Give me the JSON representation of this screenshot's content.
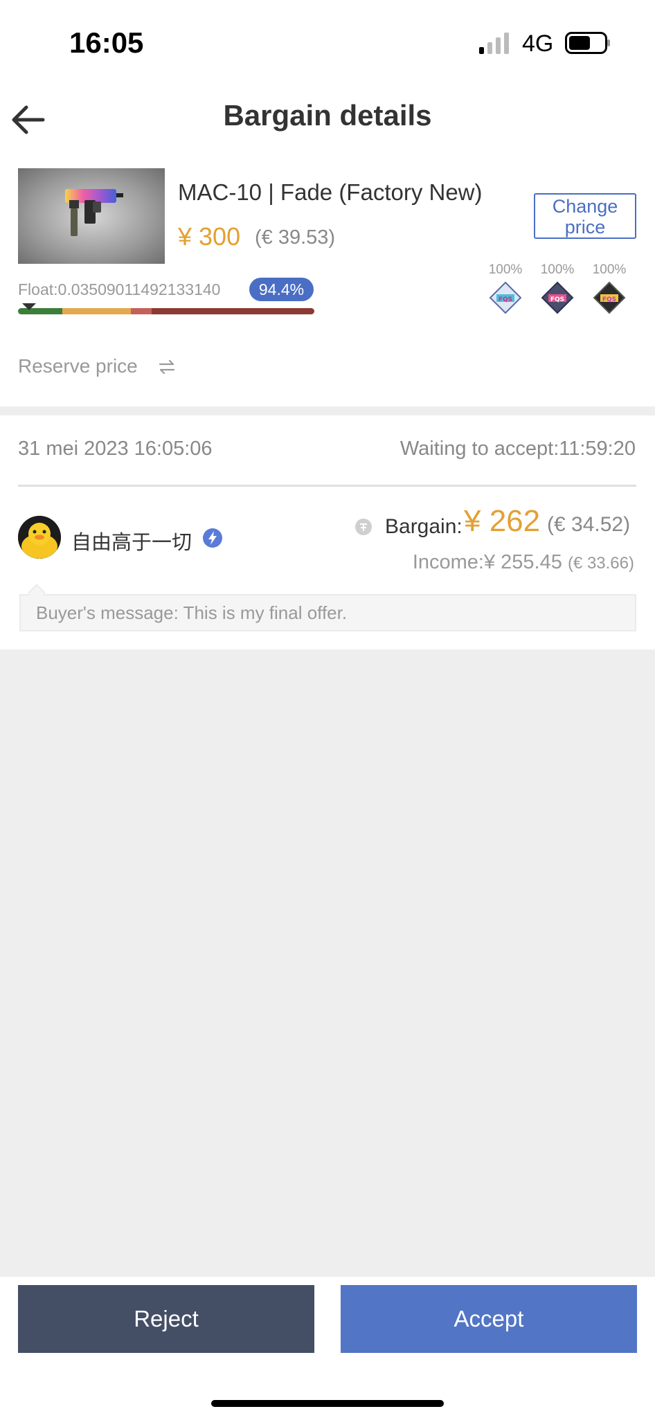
{
  "status_bar": {
    "time": "16:05",
    "network": "4G",
    "icons": [
      "signal-icon",
      "battery-icon"
    ]
  },
  "nav": {
    "title": "Bargain details",
    "back_icon": "arrow-left-icon"
  },
  "item": {
    "name": "MAC-10 | Fade (Factory New)",
    "price": "¥ 300",
    "price_eur": "(€ 39.53)",
    "change_price_label": "Change price",
    "float_text": "Float:0.03509011492133140",
    "wear_percent": "94.4%",
    "stickers": [
      {
        "percent": "100%",
        "icon": "sticker-icon"
      },
      {
        "percent": "100%",
        "icon": "sticker-icon"
      },
      {
        "percent": "100%",
        "icon": "sticker-icon"
      }
    ],
    "reserve_price_label": "Reserve price",
    "reserve_icon": "swap-icon"
  },
  "offer": {
    "date": "31 mei 2023 16:05:06",
    "waiting": "Waiting to accept:11:59:20",
    "username": "自由高于一切",
    "verified_icon": "lightning-badge-icon",
    "bargain_label": "Bargain:",
    "bargain_amount": "¥ 262",
    "bargain_eur": "(€ 34.52)",
    "income_label": "Income:¥ 255.45",
    "income_eur": "(€ 33.66)",
    "message": "Buyer's message: This is my final offer."
  },
  "actions": {
    "reject_label": "Reject",
    "accept_label": "Accept"
  },
  "colors": {
    "accent_blue": "#5275c5",
    "price_orange": "#e3a032",
    "reject_bg": "#444f66"
  }
}
